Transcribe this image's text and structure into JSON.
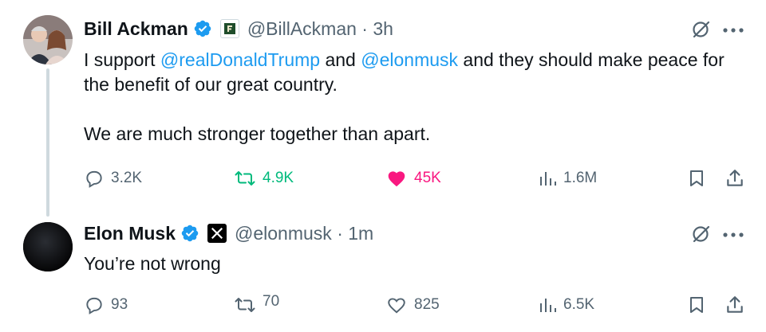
{
  "tweets": [
    {
      "name": "Bill Ackman",
      "handle": "@BillAckman · 3h",
      "text": {
        "p1_a": "I support ",
        "mention1": "@realDonaldTrump",
        "p1_b": " and ",
        "mention2": "@elonmusk",
        "p1_c": " and they should make peace for the benefit of our great country.",
        "p2": "We are much stronger together than apart."
      },
      "replies": "3.2K",
      "reposts": "4.9K",
      "likes": "45K",
      "views": "1.6M",
      "liked": true,
      "reposted": true
    },
    {
      "name": "Elon Musk",
      "handle": "@elonmusk · 1m",
      "text": "You’re not wrong",
      "replies": "93",
      "reposts": "70",
      "likes": "825",
      "views": "6.5K",
      "liked": false,
      "reposted": false
    }
  ],
  "colors": {
    "accent": "#1d9bf0",
    "like": "#f91880",
    "repost": "#00ba7c",
    "muted": "#536471"
  },
  "icons": [
    "reply-icon",
    "repost-icon",
    "like-icon",
    "views-icon",
    "bookmark-icon",
    "share-icon",
    "grok-icon",
    "more-icon",
    "verified-icon"
  ]
}
